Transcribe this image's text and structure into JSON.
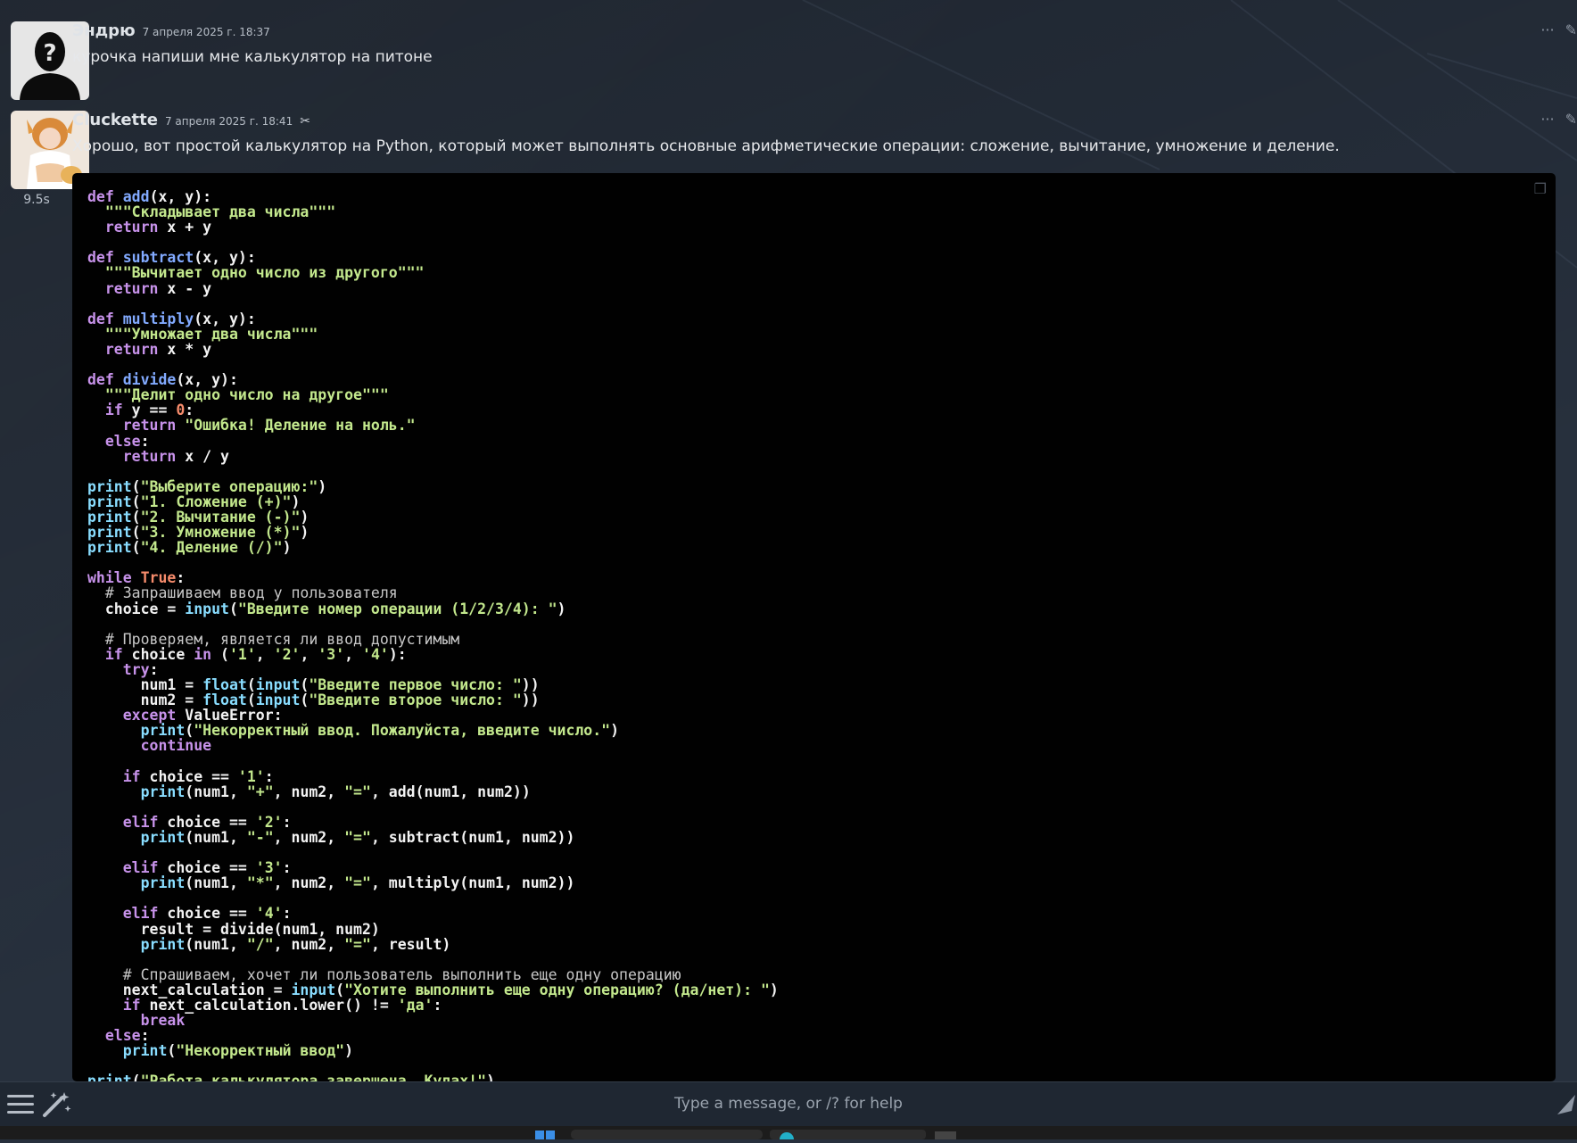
{
  "messages": [
    {
      "author": "Эндрю",
      "timestamp": "7 апреля 2025 г. 18:37",
      "text": "курочка напиши мне калькулятор на питоне"
    },
    {
      "author": "Cluckette",
      "timestamp": "7 апреля 2025 г. 18:41",
      "badge": "✂",
      "response_time": "9.5s",
      "text": "Хорошо, вот простой калькулятор на Python, который может выполнять основные арифметические операции: сложение, вычитание, умножение и деление."
    }
  ],
  "actions": {
    "more": "···",
    "edit": "✎"
  },
  "code_copy_icon": "copy-icon",
  "input": {
    "placeholder": "Type a message, or /? for help"
  }
}
